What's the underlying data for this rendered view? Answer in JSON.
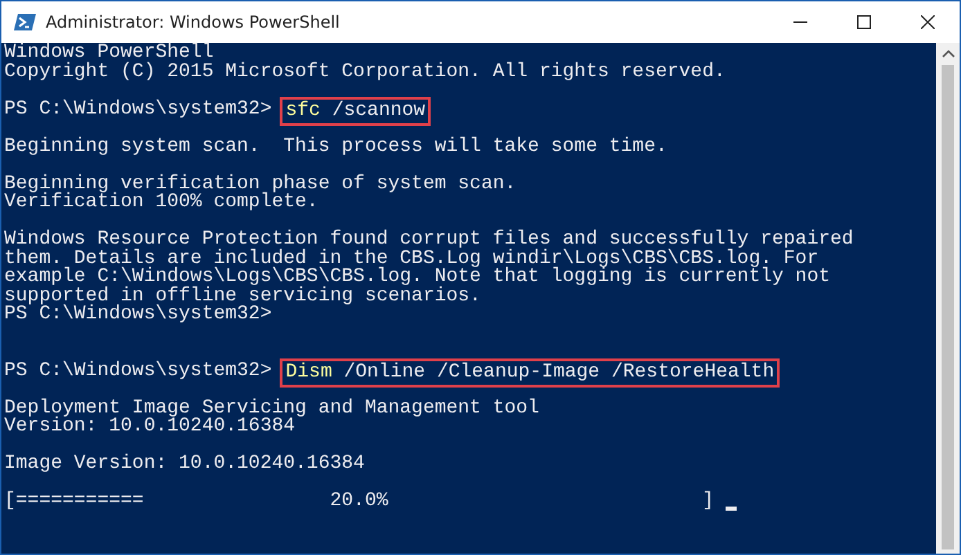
{
  "window": {
    "title": "Administrator: Windows PowerShell"
  },
  "console": {
    "lines": [
      {
        "kind": "text",
        "text": "Windows PowerShell"
      },
      {
        "kind": "text",
        "text": "Copyright (C) 2015 Microsoft Corporation. All rights reserved."
      },
      {
        "kind": "blank"
      },
      {
        "kind": "prompt",
        "prompt": "PS C:\\Windows\\system32>",
        "command": "sfc",
        "args": "/scannow",
        "highlighted": true
      },
      {
        "kind": "blank"
      },
      {
        "kind": "text",
        "text": "Beginning system scan.  This process will take some time."
      },
      {
        "kind": "blank"
      },
      {
        "kind": "text",
        "text": "Beginning verification phase of system scan."
      },
      {
        "kind": "text",
        "text": "Verification 100% complete."
      },
      {
        "kind": "blank"
      },
      {
        "kind": "text",
        "text": "Windows Resource Protection found corrupt files and successfully repaired"
      },
      {
        "kind": "text",
        "text": "them. Details are included in the CBS.Log windir\\Logs\\CBS\\CBS.log. For"
      },
      {
        "kind": "text",
        "text": "example C:\\Windows\\Logs\\CBS\\CBS.log. Note that logging is currently not"
      },
      {
        "kind": "text",
        "text": "supported in offline servicing scenarios."
      },
      {
        "kind": "prompt",
        "prompt": "PS C:\\Windows\\system32>"
      },
      {
        "kind": "blank"
      },
      {
        "kind": "blank"
      },
      {
        "kind": "prompt",
        "prompt": "PS C:\\Windows\\system32>",
        "command": "Dism",
        "args": "/Online /Cleanup-Image /RestoreHealth",
        "highlighted": true
      },
      {
        "kind": "blank"
      },
      {
        "kind": "text",
        "text": "Deployment Image Servicing and Management tool"
      },
      {
        "kind": "text",
        "text": "Version: 10.0.10240.16384"
      },
      {
        "kind": "blank"
      },
      {
        "kind": "text",
        "text": "Image Version: 10.0.10240.16384"
      },
      {
        "kind": "blank"
      },
      {
        "kind": "progress",
        "bar": "[===========",
        "percent": "20.0%",
        "end": "]",
        "cursor": true
      }
    ]
  }
}
